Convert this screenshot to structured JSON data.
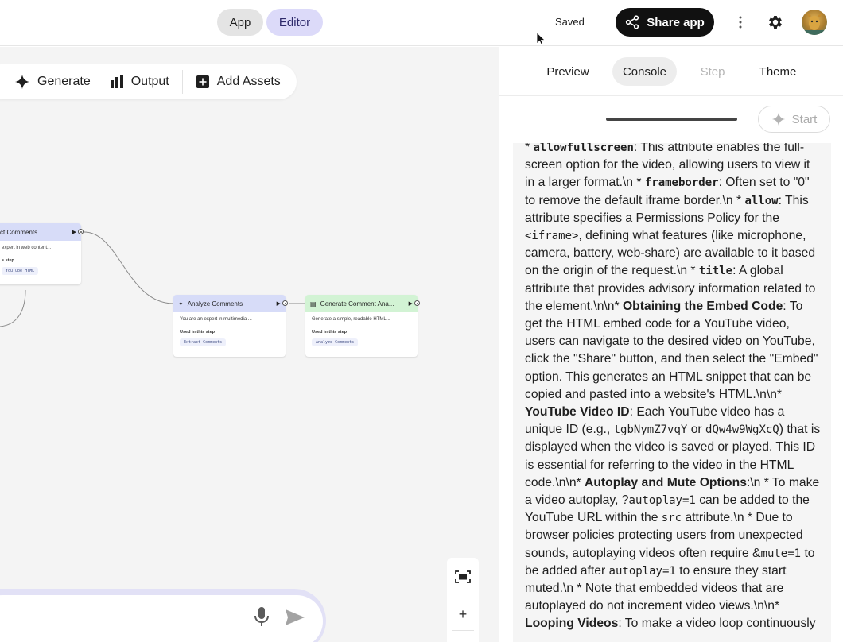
{
  "topbar": {
    "mode_app": "App",
    "mode_editor": "Editor",
    "save_status": "Saved",
    "share_label": "Share app",
    "more_icon": "more-vertical-icon",
    "settings_icon": "gear-icon"
  },
  "canvas": {
    "toolbar": {
      "generate_label": "Generate",
      "output_label": "Output",
      "add_assets_label": "Add Assets"
    },
    "nodes": {
      "extract": {
        "title": "ct Comments",
        "body": "expert in web content...",
        "used": "s step",
        "chip": "YouTube HTML"
      },
      "analyze": {
        "title": "Analyze Comments",
        "body": "You are an expert in multimedia ...",
        "used": "Used in this step",
        "chip": "Extract Comments"
      },
      "generate": {
        "title": "Generate Comment Ana...",
        "body": "Generate a simple, readable HTML...",
        "used": "Used in this step",
        "chip": "Analyze Comments"
      }
    },
    "zoom": {
      "fit_icon": "fit-screen-icon",
      "zoom_in": "+",
      "zoom_out": "−"
    }
  },
  "panel": {
    "tabs": [
      {
        "label": "Preview"
      },
      {
        "label": "Console"
      },
      {
        "label": "Step"
      },
      {
        "label": "Theme"
      }
    ],
    "active_tab": "Console",
    "start_label": "Start",
    "log": [
      {
        "t": "text",
        "v": "* "
      },
      {
        "t": "bcode",
        "v": "allowfullscreen"
      },
      {
        "t": "text",
        "v": ": This attribute enables the full-screen option for the video, allowing users to view it in a larger format.\\n * "
      },
      {
        "t": "bcode",
        "v": "frameborder"
      },
      {
        "t": "text",
        "v": ": Often set to \"0\" to remove the default iframe border.\\n * "
      },
      {
        "t": "bcode",
        "v": "allow"
      },
      {
        "t": "text",
        "v": ": This attribute specifies a Permissions Policy for the "
      },
      {
        "t": "code",
        "v": "<iframe>"
      },
      {
        "t": "text",
        "v": ", defining what features (like microphone, camera, battery, web-share) are available to it based on the origin of the request.\\n * "
      },
      {
        "t": "bcode",
        "v": "title"
      },
      {
        "t": "text",
        "v": ": A global attribute that provides advisory information related to the element.\\n\\n* "
      },
      {
        "t": "bold",
        "v": "Obtaining the Embed Code"
      },
      {
        "t": "text",
        "v": ": To get the HTML embed code for a YouTube video, users can navigate to the desired video on YouTube, click the \"Share\" button, and then select the \"Embed\" option. This generates an HTML snippet that can be copied and pasted into a website's HTML.\\n\\n* "
      },
      {
        "t": "bold",
        "v": "YouTube Video ID"
      },
      {
        "t": "text",
        "v": ": Each YouTube video has a unique ID (e.g., "
      },
      {
        "t": "code",
        "v": "tgbNymZ7vqY"
      },
      {
        "t": "text",
        "v": " or "
      },
      {
        "t": "code",
        "v": "dQw4w9WgXcQ"
      },
      {
        "t": "text",
        "v": ") that is displayed when the video is saved or played. This ID is essential for referring to the video in the HTML code.\\n\\n* "
      },
      {
        "t": "bold",
        "v": "Autoplay and Mute Options"
      },
      {
        "t": "text",
        "v": ":\\n * To make a video autoplay, ?"
      },
      {
        "t": "code",
        "v": "autoplay=1"
      },
      {
        "t": "text",
        "v": " can be added to the YouTube URL within the "
      },
      {
        "t": "code",
        "v": "src"
      },
      {
        "t": "text",
        "v": " attribute.\\n * Due to browser policies protecting users from unexpected sounds, autoplaying videos often require &"
      },
      {
        "t": "code",
        "v": "mute=1"
      },
      {
        "t": "text",
        "v": " to be added after "
      },
      {
        "t": "code",
        "v": "autoplay=1"
      },
      {
        "t": "text",
        "v": " to ensure they start muted.\\n * Note that embedded videos that are autoplayed do not increment video views.\\n\\n* "
      },
      {
        "t": "bold",
        "v": "Looping Videos"
      },
      {
        "t": "text",
        "v": ": To make a video loop continuously"
      }
    ]
  },
  "colors": {
    "editor_active": "#dcdaf9",
    "node_blue": "#d7dcf8",
    "node_green": "#d2f3d4",
    "share_bg": "#111111",
    "prompt_ring": "#e2e1f6"
  }
}
